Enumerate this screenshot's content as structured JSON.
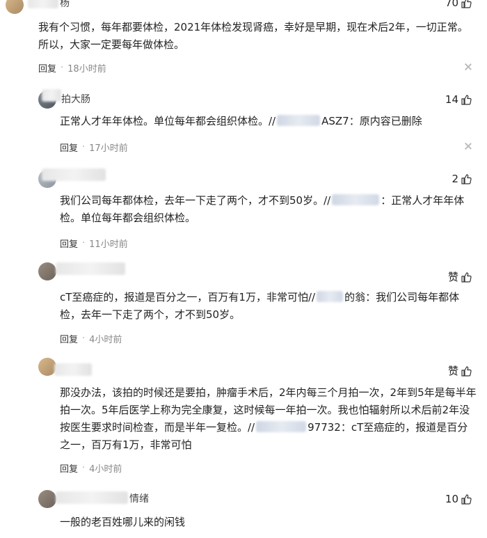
{
  "comments": [
    {
      "name_tail": "杨",
      "likes": "70",
      "text": "我有个习惯，每年都要体检，2021年体检发现肾癌，幸好是早期，现在术后2年，一切正常。所以，大家一定要每年做体检。",
      "reply_label": "回复",
      "time": "18小时前"
    },
    {
      "name_tail": "拍大肠",
      "likes": "14",
      "text_before": "正常人才年年体检。单位每年都会组织体检。//",
      "text_ref": "ASZ7",
      "text_after": "：原内容已删除",
      "reply_label": "回复",
      "time": "17小时前"
    },
    {
      "name_tail": "",
      "likes": "2",
      "text_before": "我们公司每年都体检，去年一下走了两个，才不到50岁。//",
      "text_after": "：正常人才年年体检。单位每年都会组织体检。",
      "reply_label": "回复",
      "time": "11小时前"
    },
    {
      "name_tail": "",
      "likes": "赞",
      "text_before": "cT至癌症的，报道是百分之一，百万有1万，非常可怕//",
      "text_ref": "的翁",
      "text_after": "：我们公司每年都体检，去年一下走了两个，才不到50岁。",
      "reply_label": "回复",
      "time": "4小时前"
    },
    {
      "name_tail": "",
      "likes": "赞",
      "text_before": "那没办法，该拍的时候还是要拍，肿瘤手术后，2年内每三个月拍一次，2年到5年是每半年拍一次。5年后医学上称为完全康复，这时候每一年拍一次。我也怕辐射所以术后前2年没按医生要求时间检查，而是半年一复检。//",
      "text_ref": "97732",
      "text_after": "：cT至癌症的，报道是百分之一，百万有1万，非常可怕",
      "reply_label": "回复",
      "time": "4小时前"
    },
    {
      "name_tail": "情绪",
      "likes": "10",
      "text": "一般的老百姓哪儿来的闲钱"
    }
  ]
}
